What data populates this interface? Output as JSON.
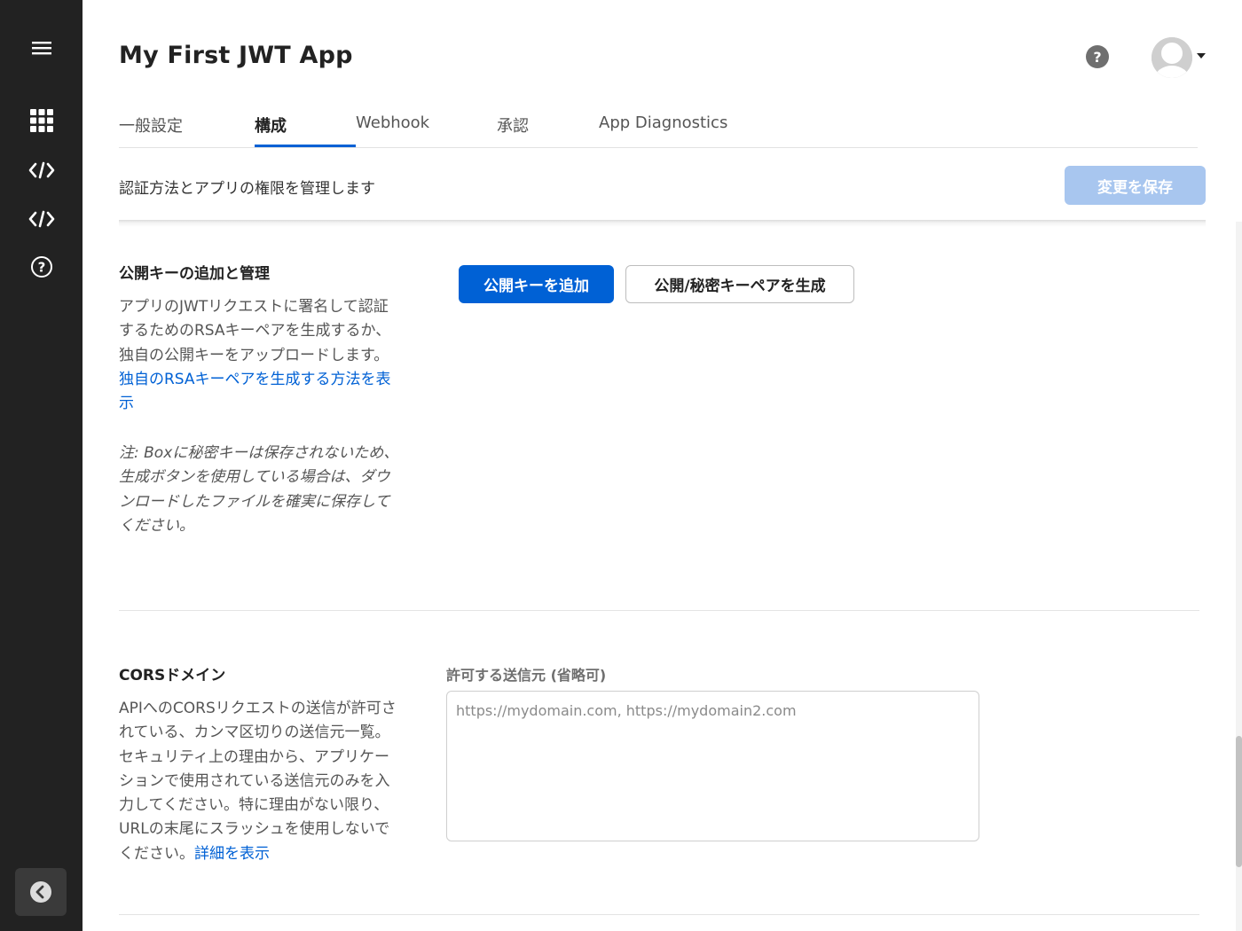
{
  "sidebar": {
    "icons": [
      "menu-icon",
      "grid-icon",
      "code-icon",
      "code-icon",
      "help-icon"
    ],
    "collapse_icon": "chevron-left-icon"
  },
  "header": {
    "app_title": "My First JWT App",
    "help_label": "?"
  },
  "tabs": [
    {
      "label": "一般設定",
      "active": false
    },
    {
      "label": "構成",
      "active": true
    },
    {
      "label": "Webhook",
      "active": false
    },
    {
      "label": "承認",
      "active": false
    },
    {
      "label": "App Diagnostics",
      "active": false
    }
  ],
  "subheader": {
    "description": "認証方法とアプリの権限を管理します",
    "save_label": "変更を保存"
  },
  "public_key_section": {
    "title": "公開キーの追加と管理",
    "description": "アプリのJWTリクエストに署名して認証するためのRSAキーペアを生成するか、独自の公開キーをアップロードします。",
    "link_text": "独自のRSAキーペアを生成する方法を表示",
    "note": "注: Boxに秘密キーは保存されないため、生成ボタンを使用している場合は、ダウンロードしたファイルを確実に保存してください。",
    "add_key_label": "公開キーを追加",
    "generate_label": "公開/秘密キーペアを生成"
  },
  "cors_section": {
    "title": "CORSドメイン",
    "description": "APIへのCORSリクエストの送信が許可されている、カンマ区切りの送信元一覧。セキュリティ上の理由から、アプリケーションで使用されている送信元のみを入力してください。特に理由がない限り、URLの末尾にスラッシュを使用しないでください。",
    "link_text": "詳細を表示",
    "field_label": "許可する送信元 (省略可)",
    "placeholder": "https://mydomain.com, https://mydomain2.com",
    "value": ""
  },
  "colors": {
    "sidebar_bg": "#222222",
    "primary": "#0061d5",
    "save_disabled": "#a8c6ef",
    "link": "#0061d5"
  }
}
